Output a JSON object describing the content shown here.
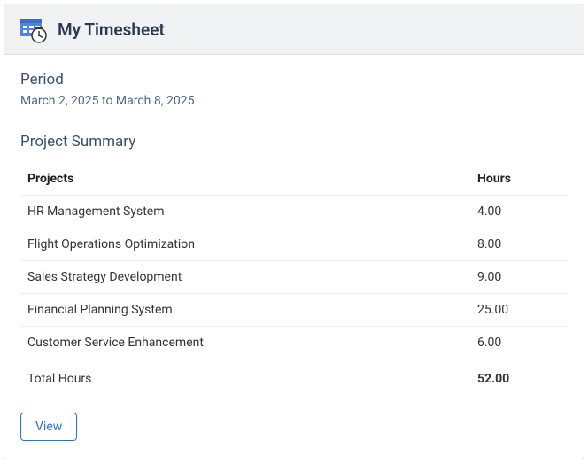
{
  "header": {
    "title": "My Timesheet"
  },
  "period": {
    "label": "Period",
    "value": "March 2, 2025 to March 8, 2025"
  },
  "summary": {
    "title": "Project Summary",
    "columns": {
      "projects": "Projects",
      "hours": "Hours"
    },
    "rows": [
      {
        "name": "HR Management System",
        "hours": "4.00"
      },
      {
        "name": "Flight Operations Optimization",
        "hours": "8.00"
      },
      {
        "name": "Sales Strategy Development",
        "hours": "9.00"
      },
      {
        "name": "Financial Planning System",
        "hours": "25.00"
      },
      {
        "name": "Customer Service Enhancement",
        "hours": "6.00"
      }
    ],
    "total": {
      "label": "Total Hours",
      "hours": "52.00"
    }
  },
  "actions": {
    "view": "View"
  }
}
